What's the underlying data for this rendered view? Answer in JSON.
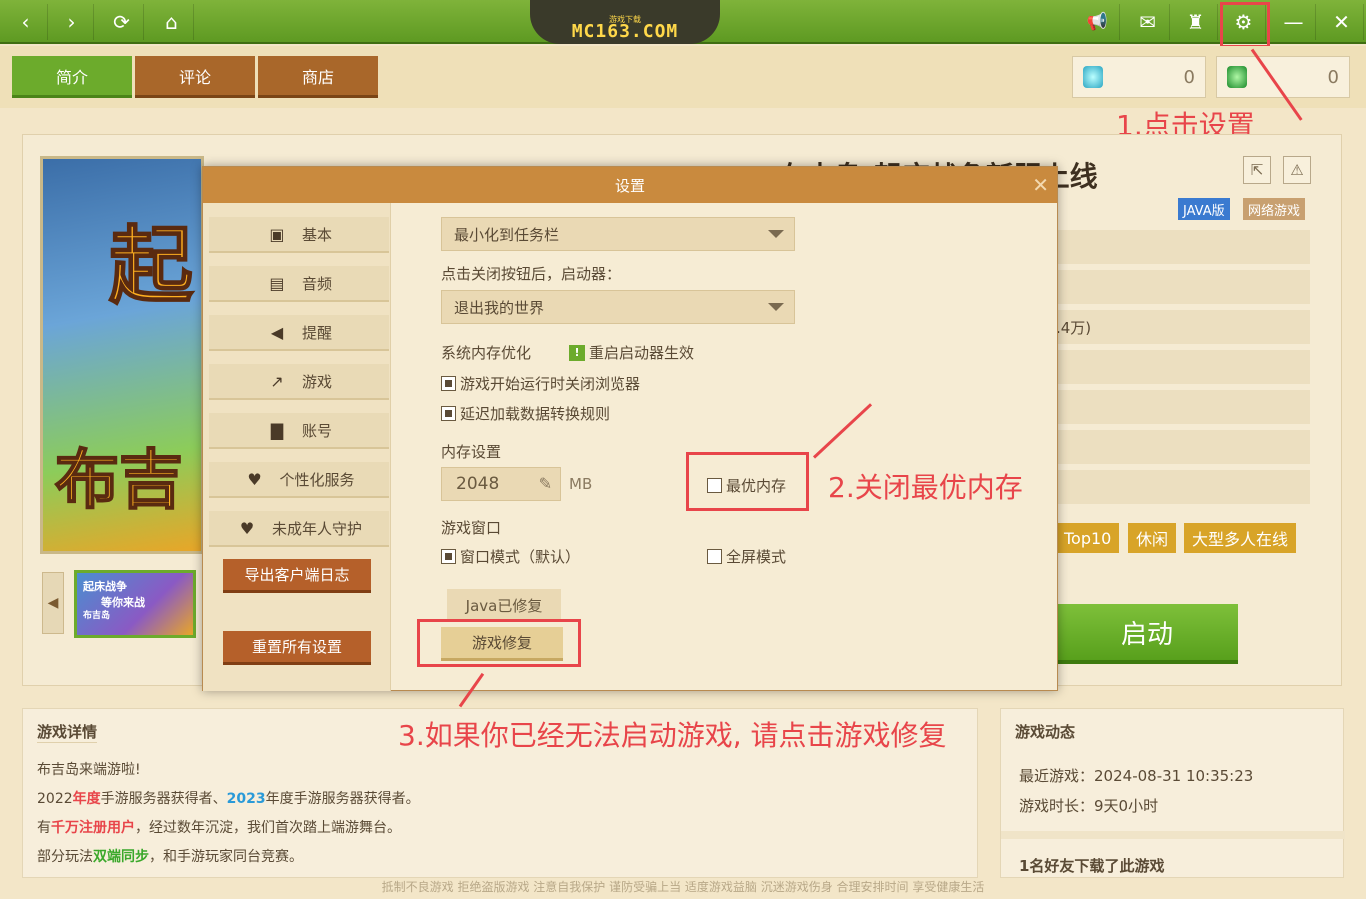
{
  "topbar": {
    "logo_text": "MC163.COM",
    "logo_small": "游戏下载",
    "buttons": [
      {
        "name": "back",
        "icon": "chevron-left-icon",
        "glyph": "‹"
      },
      {
        "name": "forward",
        "icon": "chevron-right-icon",
        "glyph": "›"
      },
      {
        "name": "refresh",
        "icon": "refresh-icon",
        "glyph": "⟳"
      },
      {
        "name": "home",
        "icon": "home-icon",
        "glyph": "⌂"
      }
    ],
    "right_buttons": [
      {
        "name": "announce",
        "icon": "megaphone-icon",
        "glyph": "📢"
      },
      {
        "name": "mail",
        "icon": "mail-icon",
        "glyph": "✉"
      },
      {
        "name": "skin",
        "icon": "shirt-icon",
        "glyph": "♜"
      },
      {
        "name": "settings",
        "icon": "gear-icon",
        "glyph": "⚙"
      },
      {
        "name": "minimize",
        "icon": "minimize-icon",
        "glyph": "—"
      },
      {
        "name": "close",
        "icon": "close-icon",
        "glyph": "✕"
      }
    ]
  },
  "tabs": [
    {
      "label": "简介",
      "active": true
    },
    {
      "label": "评论",
      "active": false
    },
    {
      "label": "商店",
      "active": false
    }
  ],
  "currency": [
    {
      "icon": "diamond-icon",
      "value": "0"
    },
    {
      "icon": "emerald-icon",
      "value": "0"
    }
  ],
  "annotations": {
    "step1": "1.点击设置",
    "step2": "2.关闭最优内存",
    "step3": "3.如果你已经无法启动游戏, 请点击游戏修复"
  },
  "game": {
    "title": "布吉岛-起床战争新服上线",
    "badges": [
      "JAVA版",
      "网络游戏"
    ],
    "info_partial": ".4万)",
    "tags": [
      "Top10",
      "休闲",
      "大型多人在线"
    ],
    "start_label": "启动",
    "banner_text_top": "起",
    "banner_text_bottom": "布吉",
    "thumb_line1": "起床战争",
    "thumb_line2": "等你来战",
    "thumb_brand": "布吉岛"
  },
  "dialog": {
    "title": "设置",
    "close_glyph": "✕",
    "sidebar": [
      {
        "label": "基本",
        "icon": "chip-icon",
        "glyph": "▣"
      },
      {
        "label": "音频",
        "icon": "speaker-icon",
        "glyph": "▤"
      },
      {
        "label": "提醒",
        "icon": "bell-icon",
        "glyph": "◀"
      },
      {
        "label": "游戏",
        "icon": "arrow-icon",
        "glyph": "↗"
      },
      {
        "label": "账号",
        "icon": "user-icon",
        "glyph": "▇"
      },
      {
        "label": "个性化服务",
        "icon": "heart-icon",
        "glyph": "♥"
      },
      {
        "label": "未成年人守护",
        "icon": "heart-shield-icon",
        "glyph": "♥"
      }
    ],
    "export_log": "导出客户端日志",
    "reset_all": "重置所有设置",
    "minimize_select": "最小化到任务栏",
    "close_label": "点击关闭按钮后，启动器：",
    "close_select": "退出我的世界",
    "mem_opt_label": "系统内存优化",
    "restart_note": "重启启动器生效",
    "restart_glyph": "!",
    "close_browser": "游戏开始运行时关闭浏览器",
    "delay_load": "延迟加载数据转换规则",
    "memory_label": "内存设置",
    "memory_value": "2048",
    "memory_unit": "MB",
    "optimal_memory": "最优内存",
    "window_label": "游戏窗口",
    "window_mode": "窗口模式（默认）",
    "fullscreen_mode": "全屏模式",
    "java_fixed": "Java已修复",
    "game_repair": "游戏修复"
  },
  "details": {
    "title": "游戏详情",
    "line1": "布吉岛来端游啦!",
    "line2_a": "2022",
    "line2_b": "年度",
    "line2_c": "手游服务器获得者、",
    "line2_d": "2023",
    "line2_e": "年度手游服务器获得者。",
    "line3_a": "有",
    "line3_b": "千万注册用户",
    "line3_c": "，经过数年沉淀，我们首次踏上端游舞台。",
    "line4_a": "部分玩法",
    "line4_b": "双端同步",
    "line4_c": "，和手游玩家同台竞赛。"
  },
  "news": {
    "title": "游戏动态",
    "recent_label": "最近游戏：",
    "recent_value": "2024-08-31 10:35:23",
    "duration_label": "游戏时长：",
    "duration_value": "9天0小时",
    "friends": "1名好友下载了此游戏"
  },
  "footer": "抵制不良游戏 拒绝盗版游戏 注意自我保护 谨防受骗上当 适度游戏益脑 沉迷游戏伤身 合理安排时间 享受健康生活",
  "colors": {
    "accent_green": "#6cab2c",
    "tab_brown": "#a9672a",
    "annotation_red": "#e8454a",
    "dialog_title": "#c98a3e"
  }
}
